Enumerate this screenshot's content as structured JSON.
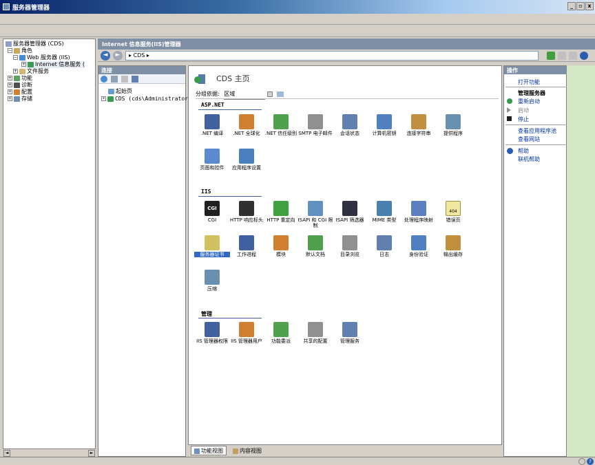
{
  "window": {
    "title": "服务器管理器",
    "min": "_",
    "max": "▫",
    "close": "x"
  },
  "tree": {
    "root": "服务器管理器 (CDS)",
    "items": [
      {
        "label": "角色",
        "pm": "⊟"
      },
      {
        "label": "Web 服务器 (IIS)",
        "pm": "⊟"
      },
      {
        "label": "Internet 信息服务 (",
        "pm": "⊞"
      },
      {
        "label": "文件服务",
        "pm": "⊞"
      },
      {
        "label": "功能",
        "pm": "⊞"
      },
      {
        "label": "诊断",
        "pm": "⊞"
      },
      {
        "label": "配置",
        "pm": "⊞"
      },
      {
        "label": "存储",
        "pm": "⊞"
      }
    ],
    "scroll_left": "◄",
    "scroll_right": "►"
  },
  "iis": {
    "header": "Internet 信息服务(IIS)管理器",
    "back": "◄",
    "forward": "►",
    "address": "▸ CDS ▸"
  },
  "connections": {
    "header": "连接",
    "items": [
      "起始页",
      "CDS (cds\\Administrator)"
    ]
  },
  "content": {
    "title": "CDS 主页",
    "group_label": "分组依据:",
    "group_value": "区域",
    "sections": {
      "aspnet": "ASP.NET",
      "iis": "IIS",
      "manage": "管理"
    },
    "aspnet_features": [
      ".NET 编译",
      ".NET 全球化",
      ".NET 信任级别",
      "SMTP 电子邮件",
      "会话状态",
      "计算机密钥",
      "连接字符串",
      "提供程序",
      "页面和控件",
      "应用程序设置"
    ],
    "iis_features": [
      "CGI",
      "HTTP 响应标头",
      "HTTP 重定向",
      "ISAPI 和 CGI 限制",
      "ISAPI 筛选器",
      "MIME 类型",
      "处理程序映射",
      "错误页",
      "服务器证书",
      "工作进程",
      "模块",
      "默认文档",
      "目录浏览",
      "日志",
      "身份验证",
      "输出缓存",
      "压缩"
    ],
    "manage_features": [
      "IIS 管理器权限",
      "IIS 管理器用户",
      "功能委派",
      "共享的配置",
      "管理服务"
    ],
    "cgi_text": "CGI",
    "error_text": "404"
  },
  "viewtabs": {
    "features": "功能视图",
    "content": "内容视图"
  },
  "actions": {
    "header": "操作",
    "open_feature": "打开功能",
    "manage_server": "管理服务器",
    "restart": "重新启动",
    "start": "启动",
    "stop": "停止",
    "view_app_pools": "查看应用程序池",
    "view_sites": "查看网站",
    "help": "帮助",
    "online_help": "联机帮助"
  },
  "colors": {
    "accent": "#316ac5",
    "header": "#7f8fa6",
    "link": "#0033aa"
  }
}
